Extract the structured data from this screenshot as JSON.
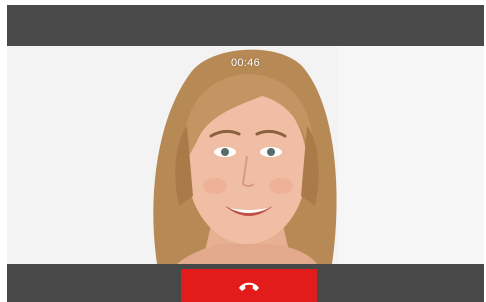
{
  "call": {
    "elapsed_time": "00:46",
    "end_call_icon": "phone-hangup-icon",
    "end_call_color": "#e21b1b"
  },
  "remote_video": {
    "subject": "participant-video"
  }
}
